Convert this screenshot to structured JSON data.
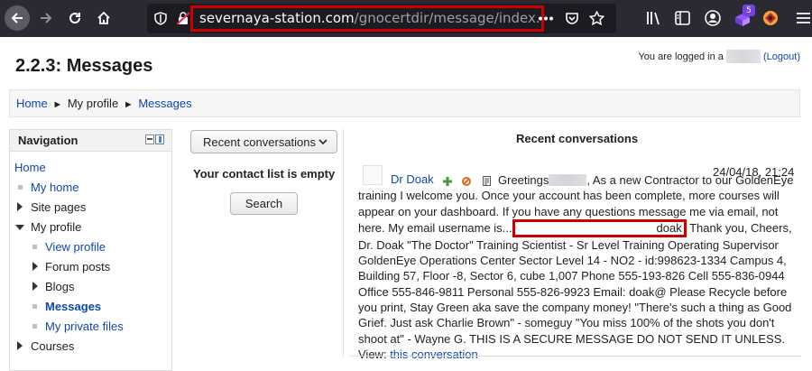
{
  "browser": {
    "url_domain": "severnaya-station.com",
    "url_path": "/gnocertdir/message/index.ph",
    "extension_badge": "5",
    "icons": [
      "back-arrow-icon",
      "forward-arrow-icon",
      "reload-icon",
      "home-icon",
      "shield-icon",
      "lock-insecure-icon",
      "more-dots-icon",
      "pocket-icon",
      "bookmark-star-icon",
      "library-icon",
      "sidebar-icon",
      "account-icon",
      "extension-icon",
      "extension-red-icon"
    ]
  },
  "header": {
    "title": "2.2.3: Messages",
    "login_prefix": "You are logged in a",
    "logout_label": "(Logout)"
  },
  "breadcrumb": {
    "home": "Home",
    "separator": "►",
    "my_profile": "My profile",
    "messages": "Messages"
  },
  "navigation": {
    "title": "Navigation",
    "items": [
      {
        "label": "Home",
        "type": "link"
      },
      {
        "label": "My home",
        "type": "link"
      },
      {
        "label": "Site pages",
        "type": "collapsed"
      },
      {
        "label": "My profile",
        "type": "expanded"
      },
      {
        "label": "View profile",
        "type": "link"
      },
      {
        "label": "Forum posts",
        "type": "collapsed"
      },
      {
        "label": "Blogs",
        "type": "collapsed"
      },
      {
        "label": "Messages",
        "type": "active"
      },
      {
        "label": "My private files",
        "type": "link"
      },
      {
        "label": "Courses",
        "type": "collapsed"
      }
    ]
  },
  "contacts": {
    "dropdown_label": "Recent conversations",
    "empty_text": "Your contact list is empty",
    "search_label": "Search"
  },
  "conversations": {
    "title": "Recent conversations",
    "message": {
      "author": "Dr Doak",
      "date": "24/04/18, 21:24",
      "text_before": "Greetings",
      "text_mid": ", As a new Contractor to our GoldenEye training I welcome you. Once your account has been complete, more courses will appear on your dashboard. If you have any questions message me via email, not here. My email username is...",
      "email_user": "doak",
      "text_after": "Thank you, Cheers, Dr. Doak \"The Doctor\" Training Scientist - Sr Level Training Operating Supervisor GoldenEye Operations Center Sector Level 14 - NO2 - id:998623-1334 Campus 4, Building 57, Floor -8, Sector 6, cube 1,007 Phone 555-193-826 Cell 555-836-0944 Office 555-846-9811 Personal 555-826-9923 Email: doak@ Please Recycle before you print, Stay Green aka save the company money! \"There's such a thing as Good Grief. Just ask Charlie Brown\" - someguy \"You miss 100% of the shots you don't shoot at\" - Wayne G. THIS IS A SECURE MESSAGE DO NOT SEND IT UNLESS.",
      "view_prefix": "View:",
      "view_link": "this conversation"
    }
  }
}
